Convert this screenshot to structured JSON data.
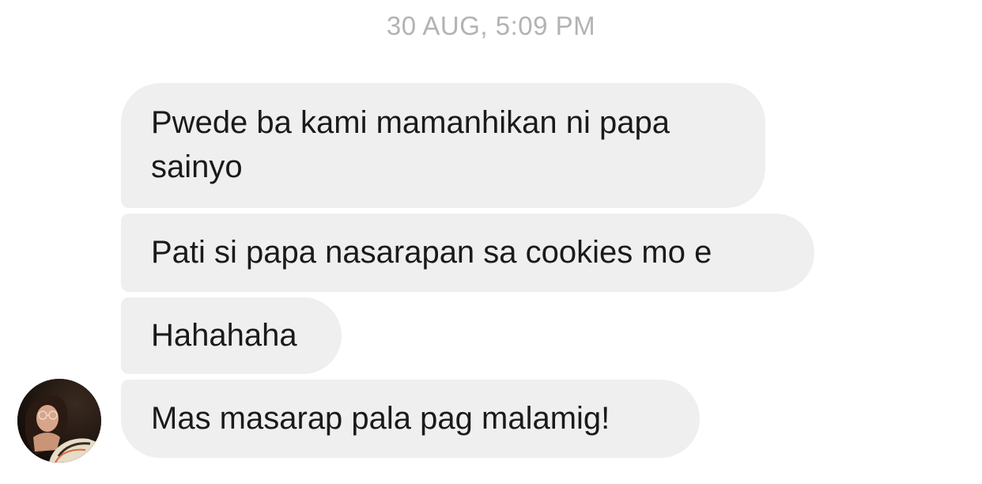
{
  "conversation": {
    "timestamp": "30 AUG, 5:09 PM",
    "messages": [
      {
        "text": "Pwede ba kami mamanhikan ni papa\nsainyo"
      },
      {
        "text": "Pati si papa nasarapan sa cookies mo e"
      },
      {
        "text": "Hahahaha"
      },
      {
        "text": "Mas masarap pala pag malamig!"
      }
    ],
    "sender": {
      "avatar_icon": "profile-photo"
    }
  },
  "colors": {
    "bubble": "#efefef",
    "timestamp": "#b3b3b3",
    "text": "#1a1a1a",
    "background": "#ffffff"
  }
}
